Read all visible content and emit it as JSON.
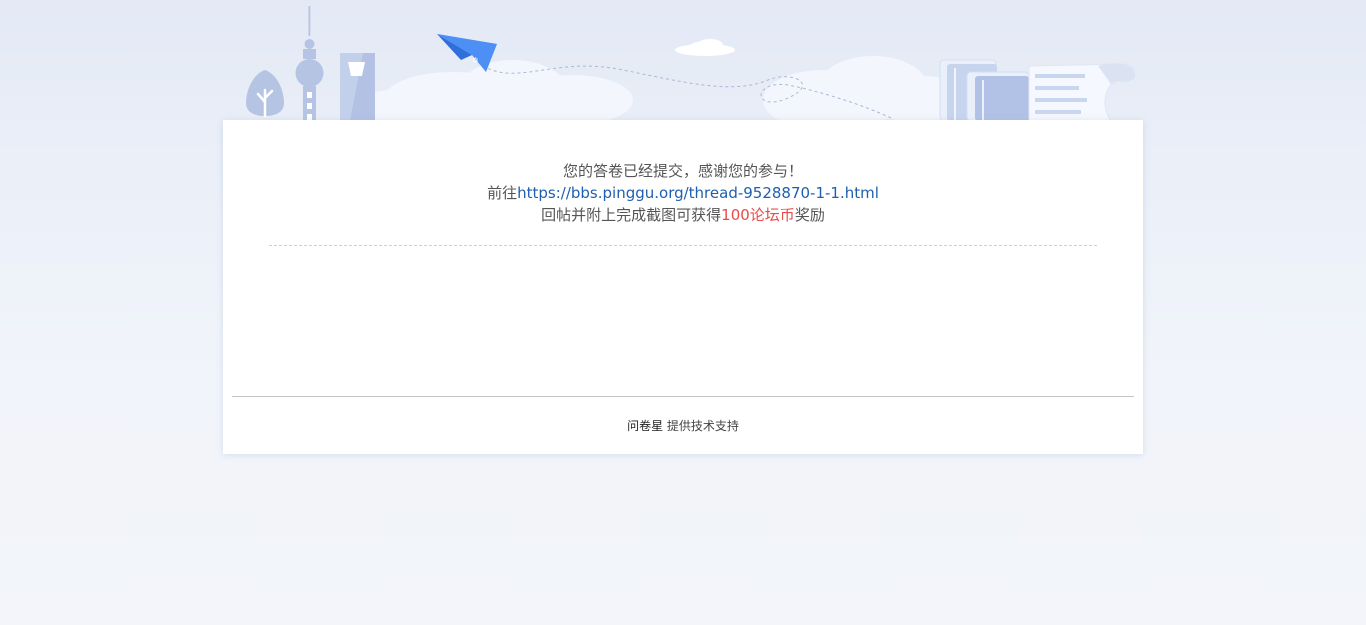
{
  "message": {
    "line1": "您的答卷已经提交，感谢您的参与！",
    "line2_prefix": "前往",
    "link": "https://bbs.pinggu.org/thread-9528870-1-1.html",
    "line3_prefix": "回帖并附上完成截图可获得",
    "reward": "100论坛币",
    "line3_suffix": "奖励"
  },
  "footer": {
    "brand": "问卷星",
    "support": "提供技术支持"
  },
  "colors": {
    "link": "#1f5fb0",
    "reward": "#e84b4b",
    "illustration": "#b9c8e6",
    "plane": "#4d8ff5"
  },
  "illustration": {
    "icons": [
      "tree-icon",
      "tv-tower-icon",
      "skyscraper-icon",
      "paper-plane-icon",
      "cloud-icon",
      "books-icon",
      "paper-scroll-icon"
    ]
  }
}
